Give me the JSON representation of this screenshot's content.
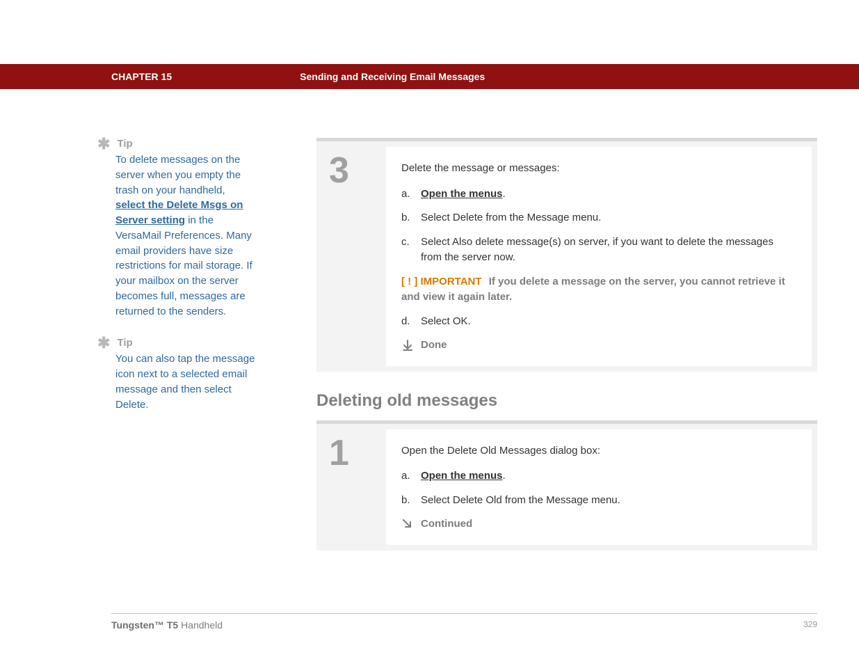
{
  "header": {
    "chapter": "CHAPTER 15",
    "title": "Sending and Receiving Email Messages"
  },
  "sidebar": {
    "tips": [
      {
        "label": "Tip",
        "pre": "To delete messages on the server when you empty the trash on your handheld, ",
        "link": "select the Delete Msgs on Server setting",
        "post": " in the VersaMail Preferences. Many email providers have size restrictions for mail storage. If your mailbox on the server becomes full, messages are returned to the senders."
      },
      {
        "label": "Tip",
        "pre": "You can also tap the message icon next to a selected email message and then select Delete.",
        "link": "",
        "post": ""
      }
    ]
  },
  "steps": {
    "step3": {
      "number": "3",
      "lead": "Delete the message or messages:",
      "a_letter": "a.",
      "a_link": "Open the menus",
      "a_suffix": ".",
      "b_letter": "b.",
      "b_text": "Select Delete from the Message menu.",
      "c_letter": "c.",
      "c_text": "Select Also delete message(s) on server, if you want to delete the messages from the server now.",
      "important_badge": "[ ! ] IMPORTANT",
      "important_text": " If you delete a message on the server, you cannot retrieve it and view it again later.",
      "d_letter": "d.",
      "d_text": "Select OK.",
      "done": "Done"
    },
    "heading2": "Deleting old messages",
    "step1": {
      "number": "1",
      "lead": "Open the Delete Old Messages dialog box:",
      "a_letter": "a.",
      "a_link": "Open the menus",
      "a_suffix": ".",
      "b_letter": "b.",
      "b_text": "Select Delete Old from the Message menu.",
      "continued": "Continued"
    }
  },
  "footer": {
    "product_bold": "Tungsten™ T5",
    "product_rest": " Handheld",
    "page": "329"
  }
}
